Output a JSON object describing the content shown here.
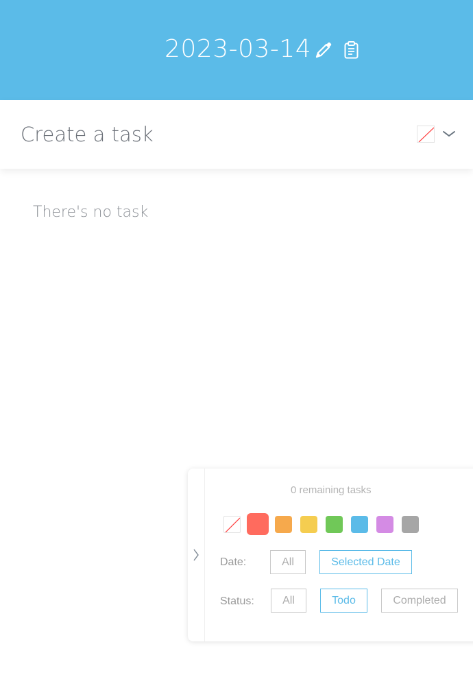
{
  "header": {
    "date": "2023-03-14",
    "edit_icon": "pencil-icon",
    "clipboard_icon": "clipboard-icon",
    "background": "#5bbbe8"
  },
  "create": {
    "placeholder": "Create a task",
    "color_selector_icon": "no-color-icon",
    "expand_icon": "chevron-down-icon"
  },
  "task_list": {
    "empty_message": "There's no task"
  },
  "filter_panel": {
    "toggle_icon": "chevron-right-icon",
    "remaining": "0 remaining tasks",
    "colors": [
      {
        "name": "none",
        "hex": ""
      },
      {
        "name": "red",
        "hex": "#ff6b5e",
        "selected": true
      },
      {
        "name": "orange",
        "hex": "#f6a94c"
      },
      {
        "name": "yellow",
        "hex": "#f5cd50"
      },
      {
        "name": "green",
        "hex": "#70c858"
      },
      {
        "name": "blue",
        "hex": "#5bbbe8"
      },
      {
        "name": "purple",
        "hex": "#d48be4"
      },
      {
        "name": "gray",
        "hex": "#a6a6a6"
      }
    ],
    "date_label": "Date:",
    "date_options": [
      "All",
      "Selected Date"
    ],
    "date_active": "Selected Date",
    "status_label": "Status:",
    "status_options": [
      "All",
      "Todo",
      "Completed"
    ],
    "status_active": "Todo"
  }
}
